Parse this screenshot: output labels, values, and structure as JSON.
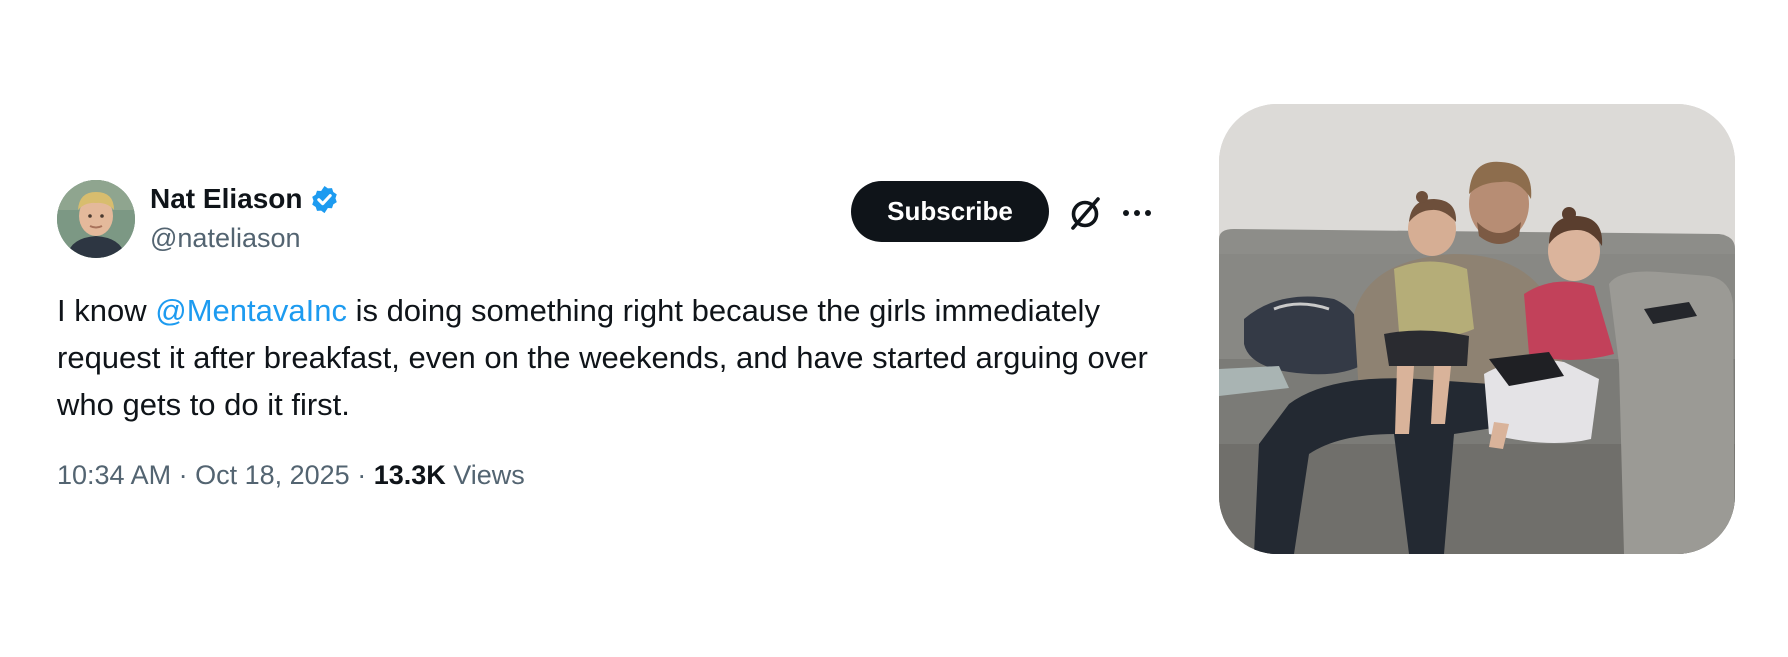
{
  "tweet": {
    "author": {
      "name": "Nat Eliason",
      "handle": "@nateliason",
      "verified": true,
      "avatar_icon": "user-avatar"
    },
    "subscribe_label": "Subscribe",
    "text": {
      "before": "I know ",
      "mention": "@MentavaInc",
      "after": " is doing something right because the girls immediately request it after breakfast, even on the weekends, and have started arguing over who gets to do it first."
    },
    "meta": {
      "time": "10:34 AM",
      "separator": " · ",
      "date": "Oct 18, 2025",
      "views_count": "13.3K",
      "views_label": "Views"
    },
    "media": {
      "type": "photo"
    }
  },
  "colors": {
    "text": "#0f1419",
    "secondary": "#536471",
    "link": "#1d9bf0",
    "button_bg": "#0f1419",
    "button_text": "#ffffff"
  }
}
